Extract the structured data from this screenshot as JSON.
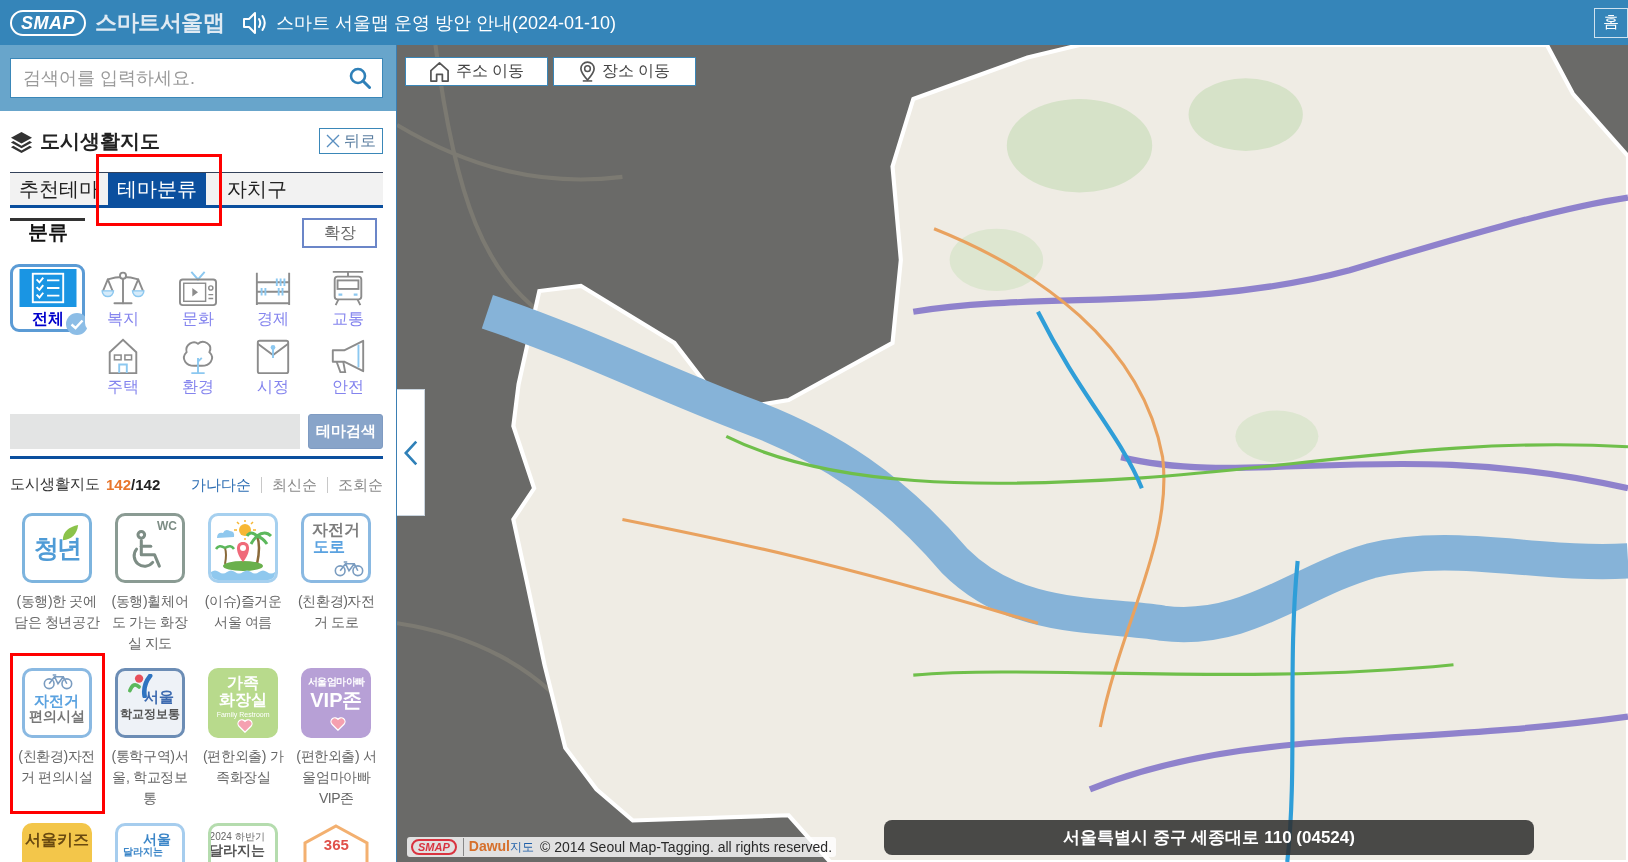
{
  "header": {
    "logo": "SMAP",
    "app_name": "스마트서울맵",
    "notice": "스마트 서울맵 운영 방안 안내(2024-01-10)",
    "home_button": "홈"
  },
  "search": {
    "placeholder": "검색어를 입력하세요."
  },
  "panel": {
    "title": "도시생활지도",
    "back_button": "뒤로"
  },
  "tabs": [
    {
      "label": "추천테마",
      "selected": false,
      "highlighted": false
    },
    {
      "label": "테마분류",
      "selected": true,
      "highlighted": true
    },
    {
      "label": "자치구",
      "selected": false,
      "highlighted": false
    }
  ],
  "category": {
    "heading": "분류",
    "expand_button": "확장",
    "items": [
      {
        "label": "전체",
        "selected": true
      },
      {
        "label": "복지",
        "selected": false
      },
      {
        "label": "문화",
        "selected": false
      },
      {
        "label": "경제",
        "selected": false
      },
      {
        "label": "교통",
        "selected": false
      },
      {
        "label": "주택",
        "selected": false
      },
      {
        "label": "환경",
        "selected": false
      },
      {
        "label": "시정",
        "selected": false
      },
      {
        "label": "안전",
        "selected": false
      }
    ]
  },
  "theme_search": {
    "button": "테마검색"
  },
  "theme_list": {
    "title": "도시생활지도",
    "count": "142",
    "total": "/142",
    "sort": [
      {
        "label": "가나다순",
        "selected": true
      },
      {
        "label": "최신순",
        "selected": false
      },
      {
        "label": "조회순",
        "selected": false
      }
    ],
    "items": [
      {
        "label": "(동행)한 곳에 담은 청년공간",
        "kind": "outline",
        "color": "#7db4de",
        "icon_text": [
          "청년"
        ],
        "highlighted": false
      },
      {
        "label": "(동행)휠체어도 가는 화장실 지도",
        "kind": "outline",
        "color": "#8a9b93",
        "icon_text": [
          "WC"
        ],
        "highlighted": false
      },
      {
        "label": "(이슈)즐거운 서울 여름",
        "kind": "outline",
        "color": "#a6d0ef",
        "highlighted": false
      },
      {
        "label": "(친환경)자전거 도로",
        "kind": "outline",
        "color": "#8ab9e2",
        "icon_text": [
          "자전거",
          "도로"
        ],
        "highlighted": false
      },
      {
        "label": "(친환경)자전거 편의시설",
        "kind": "outline",
        "color": "#8ab9e2",
        "icon_text": [
          "자전거",
          "편의시설"
        ],
        "highlighted": true
      },
      {
        "label": "(통학구역)서울, 학교정보통",
        "kind": "outline",
        "color": "#6c8db5",
        "icon_text": [
          "서울",
          "학교정보통"
        ],
        "highlighted": false
      },
      {
        "label": "(편한외출) 가족화장실",
        "kind": "filled",
        "color": "#b8da8c",
        "icon_text": [
          "가족",
          "화장실",
          "Family Restroom"
        ],
        "highlighted": false
      },
      {
        "label": "(편한외출) 서울엄마아빠VIP존",
        "kind": "filled",
        "color": "#b7a0d6",
        "icon_text": [
          "서울엄마아빠",
          "VIP존"
        ],
        "highlighted": false
      },
      {
        "kind": "filled",
        "color": "#f3c64a",
        "icon_text": [
          "서울키즈"
        ],
        "highlighted": false
      },
      {
        "kind": "outline",
        "color": "#a6cdee",
        "icon_text": [
          "서울",
          "달라지는"
        ],
        "highlighted": false
      },
      {
        "kind": "outline",
        "color": "#b5dcae",
        "icon_text": [
          "2024 하반기",
          "달라지는"
        ],
        "highlighted": false
      },
      {
        "kind": "hexagon",
        "color": "#f3b070",
        "icon_text": [
          "365"
        ],
        "highlighted": false
      }
    ]
  },
  "map": {
    "buttons": [
      {
        "label": "주소 이동"
      },
      {
        "label": "장소 이동"
      }
    ],
    "address": "서울특별시 중구 세종대로 110 (04524)",
    "logo": "SMAP",
    "provider": "Dawul",
    "provider_suffix": "지도",
    "copyright": "© 2014 Seoul Map-Tagging. all rights reserved."
  }
}
